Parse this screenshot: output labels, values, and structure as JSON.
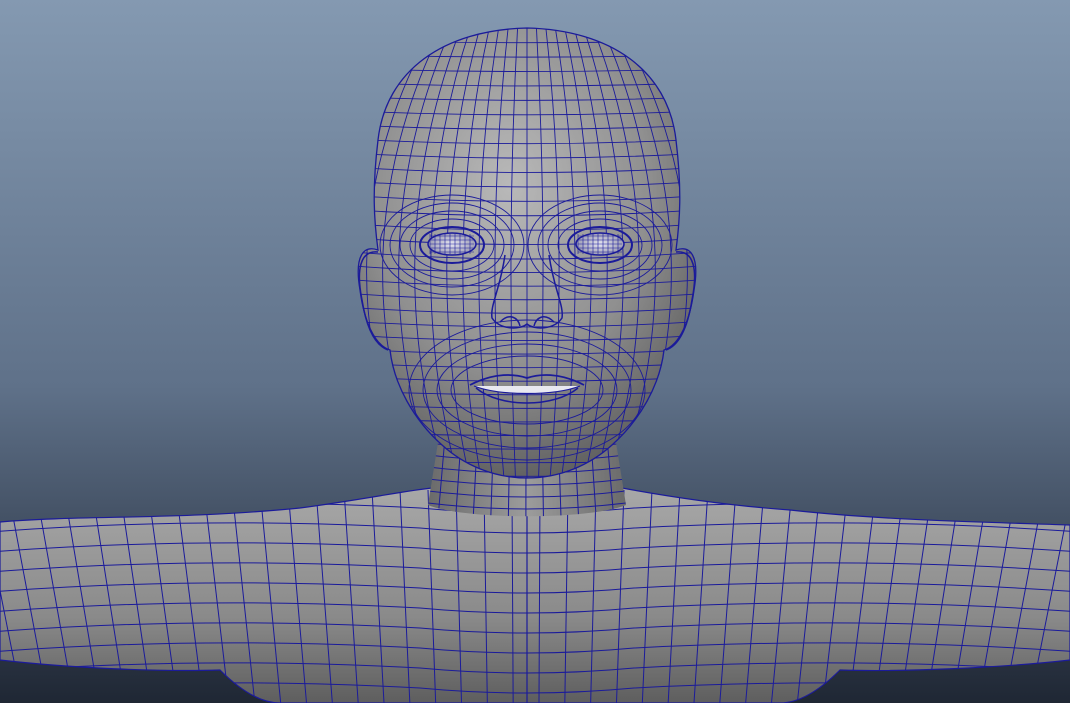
{
  "viewport": {
    "background_top": "#8499b1",
    "background_bottom": "#1f2734"
  },
  "mesh": {
    "subject": "character-bust",
    "shading": "wireframe-on-shaded",
    "surface_color": "#8c8c8c",
    "surface_highlight": "#b4b4b4",
    "surface_shadow": "#4a4a4a",
    "wire_color": "#1b1b9a"
  }
}
